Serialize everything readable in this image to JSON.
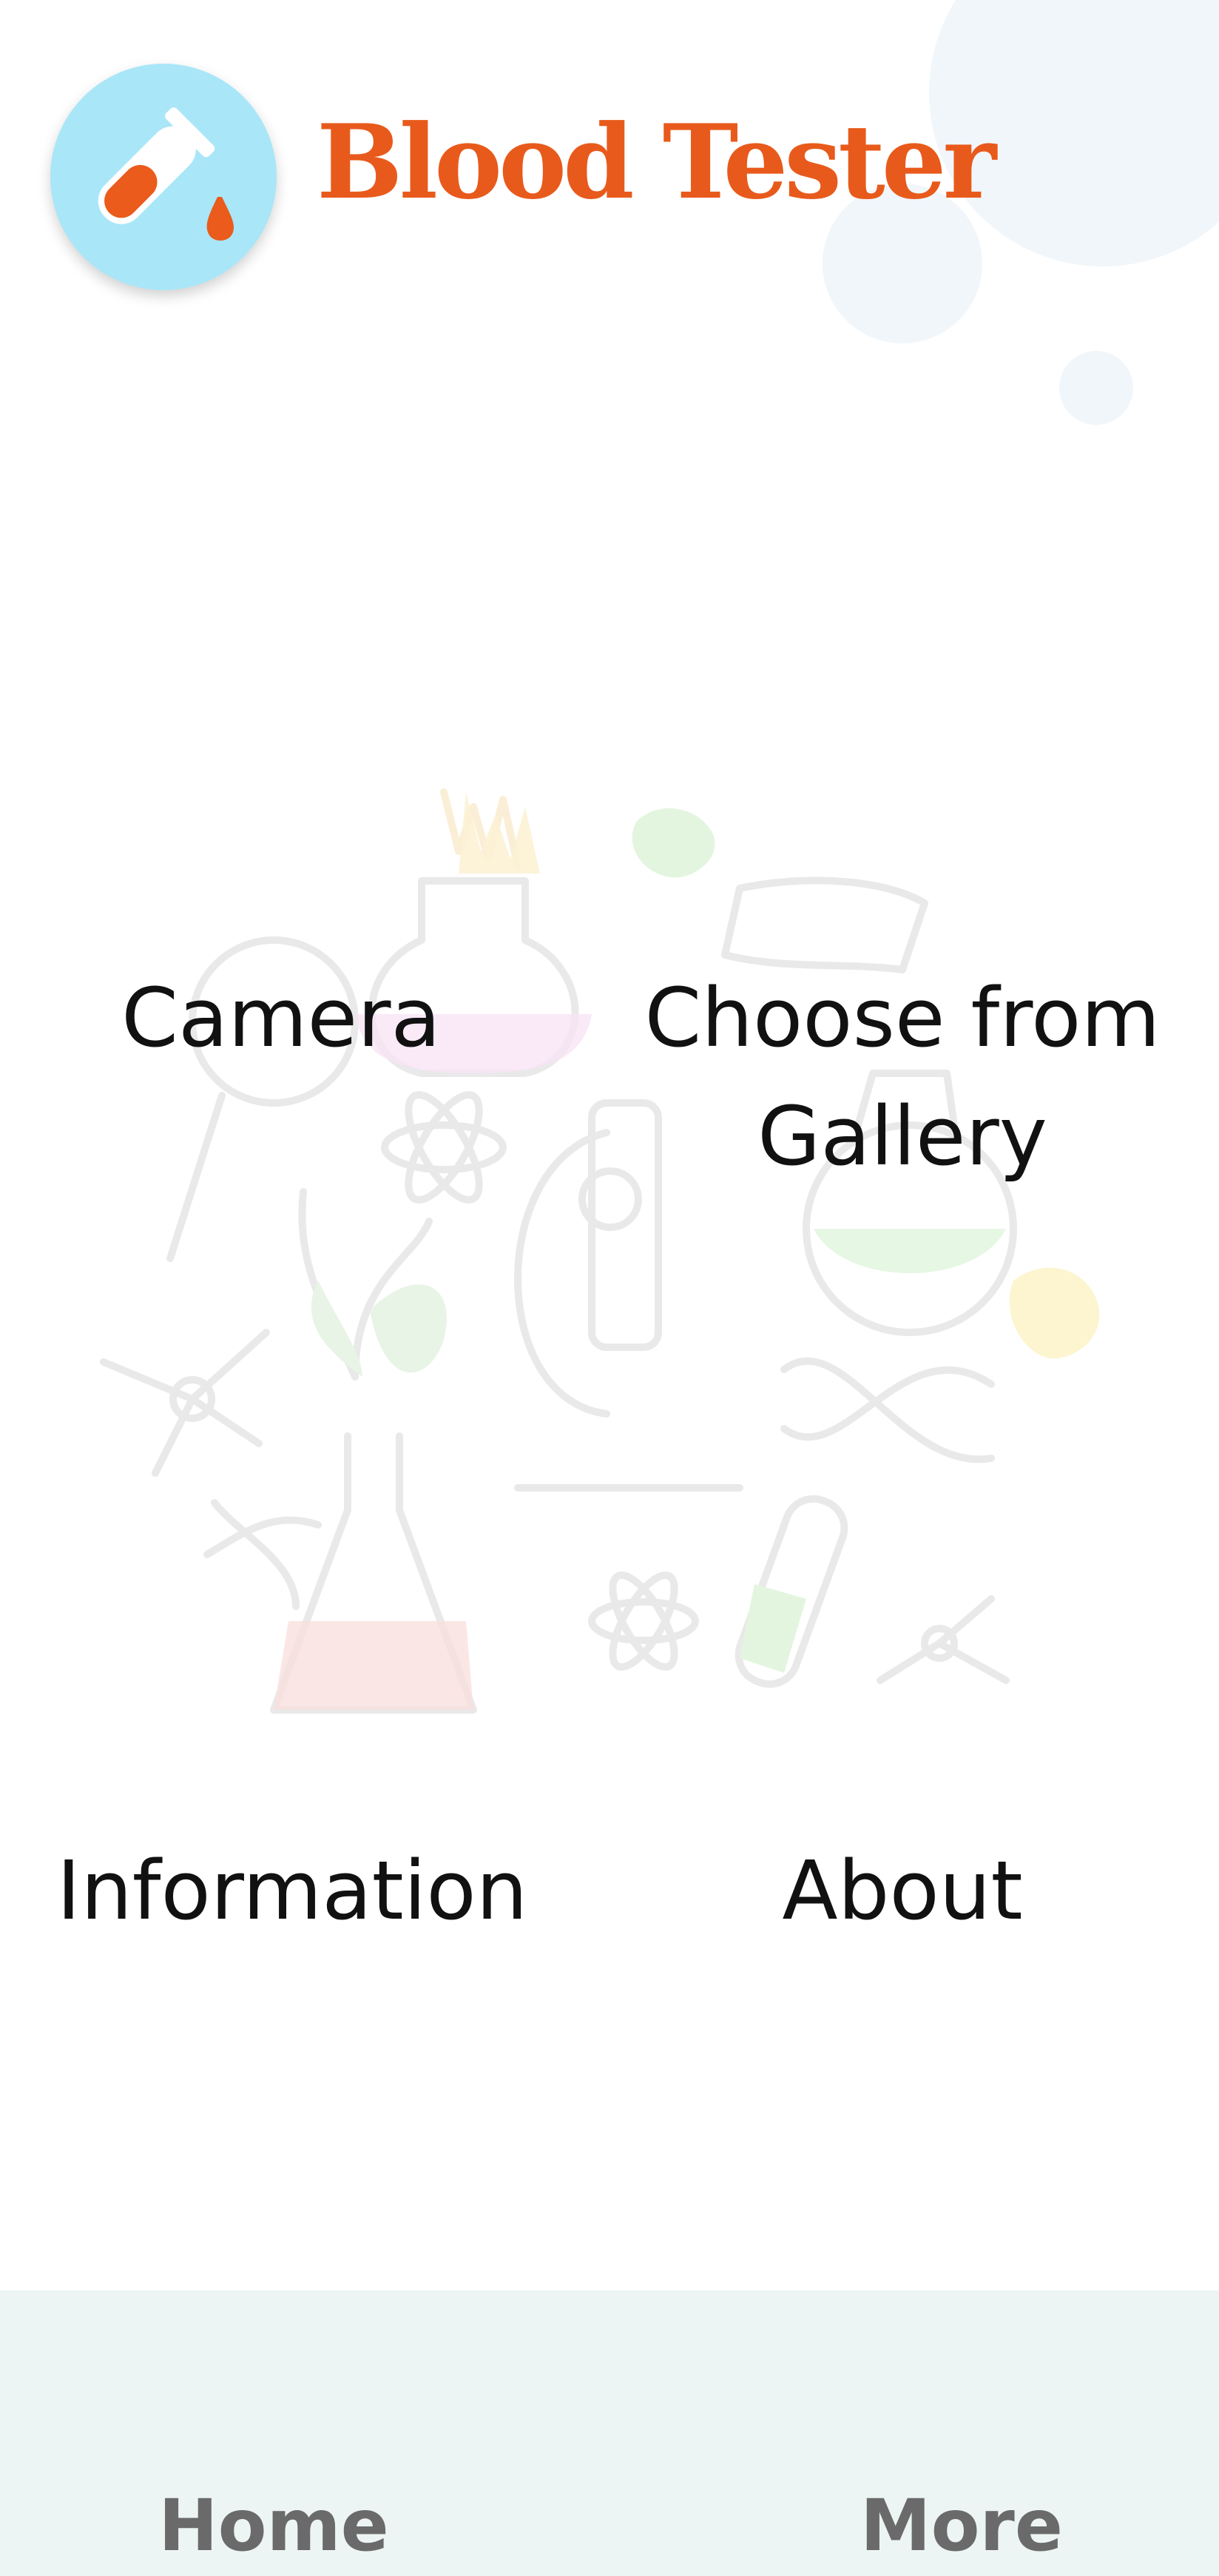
{
  "header": {
    "app_title": "Blood Tester",
    "logo_icon": "test-tube-blood-drop-icon"
  },
  "menu": {
    "camera_label": "Camera",
    "gallery_label_line1": "Choose from",
    "gallery_label_line2": "Gallery",
    "information_label": "Information",
    "about_label": "About"
  },
  "bottom_nav": {
    "home_label": "Home",
    "more_label": "More"
  },
  "colors": {
    "brand": "#e85a1b",
    "logo_background": "#a9e6f8",
    "nav_background": "#edf5f4",
    "nav_text": "#6a6a6a"
  },
  "background_illustration": "science-lab-doodle"
}
